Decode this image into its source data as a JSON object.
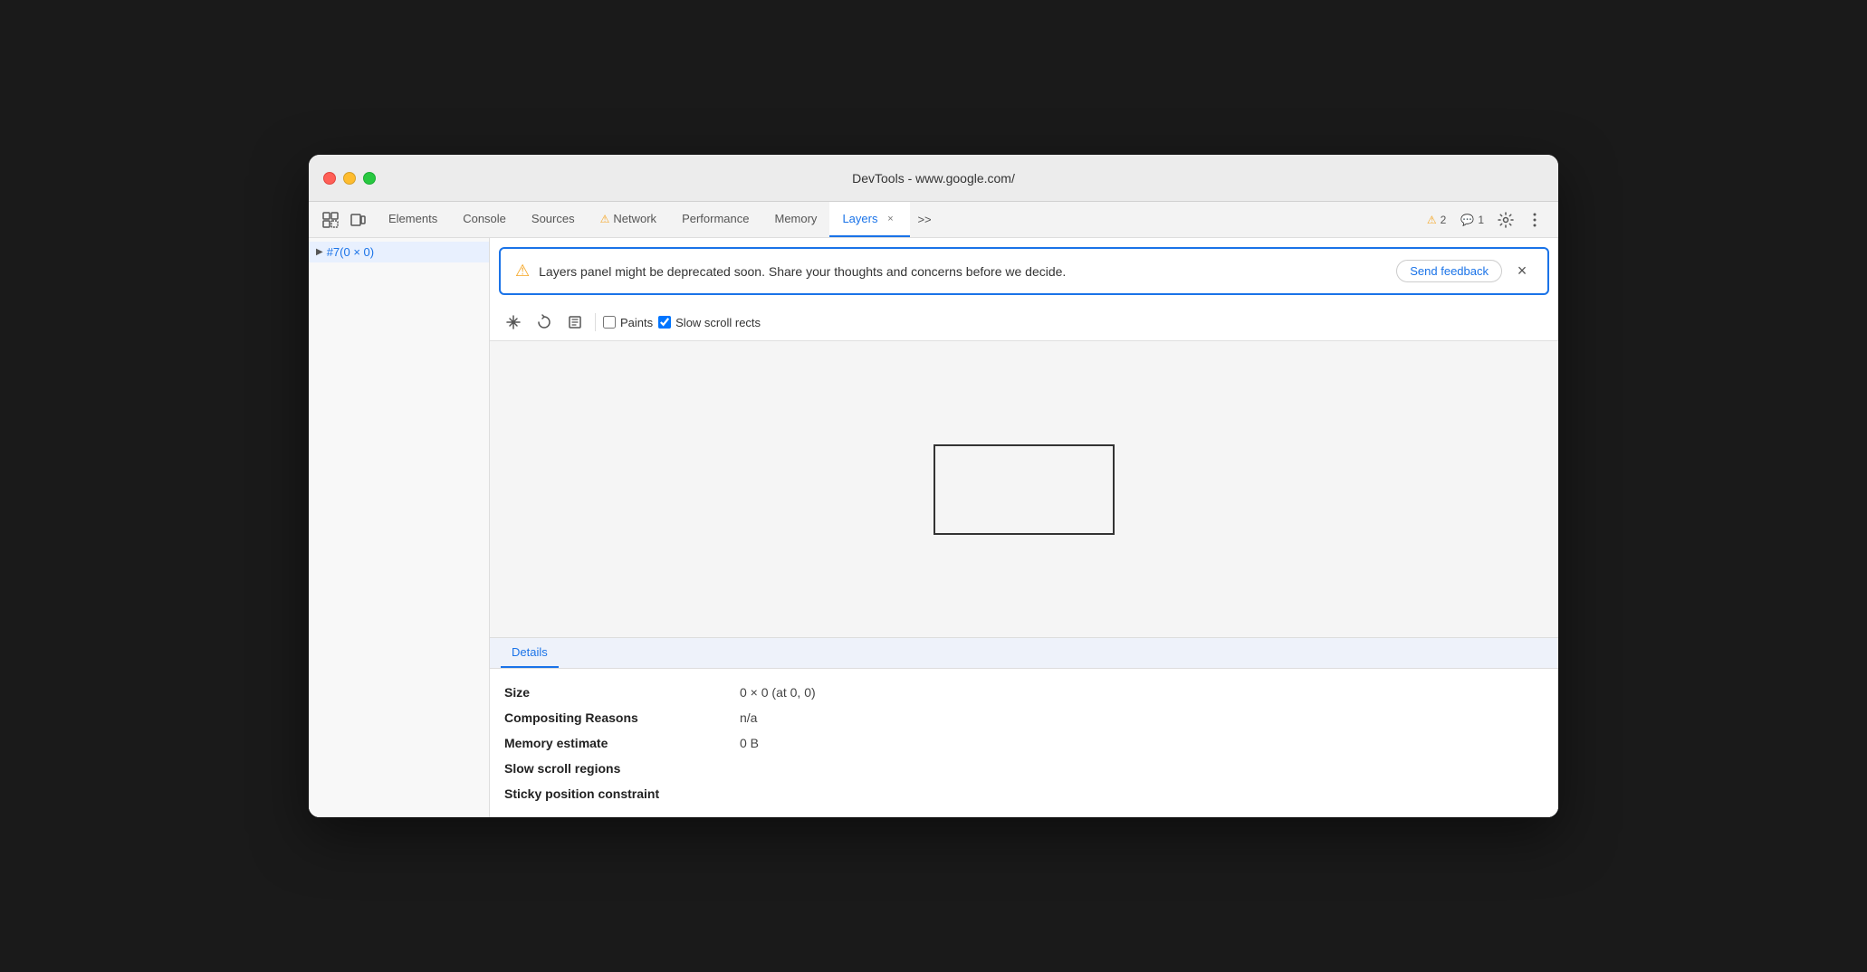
{
  "window": {
    "title": "DevTools - www.google.com/"
  },
  "tabbar": {
    "icons": [
      {
        "name": "inspect-icon",
        "symbol": "⬚",
        "interactable": true
      },
      {
        "name": "device-icon",
        "symbol": "▣",
        "interactable": true
      }
    ],
    "tabs": [
      {
        "id": "elements",
        "label": "Elements",
        "active": false,
        "hasWarning": false,
        "closable": false
      },
      {
        "id": "console",
        "label": "Console",
        "active": false,
        "hasWarning": false,
        "closable": false
      },
      {
        "id": "sources",
        "label": "Sources",
        "active": false,
        "hasWarning": false,
        "closable": false
      },
      {
        "id": "network",
        "label": "Network",
        "active": false,
        "hasWarning": true,
        "closable": false
      },
      {
        "id": "performance",
        "label": "Performance",
        "active": false,
        "hasWarning": false,
        "closable": false
      },
      {
        "id": "memory",
        "label": "Memory",
        "active": false,
        "hasWarning": false,
        "closable": false
      },
      {
        "id": "layers",
        "label": "Layers",
        "active": true,
        "hasWarning": false,
        "closable": true
      }
    ],
    "overflow_label": ">>",
    "warnings_count": "2",
    "messages_count": "1"
  },
  "sidebar": {
    "items": [
      {
        "label": "#7(0 × 0)",
        "selected": true
      }
    ]
  },
  "banner": {
    "text": "Layers panel might be deprecated soon. Share your thoughts and concerns before we decide.",
    "feedback_button": "Send feedback",
    "close_label": "×"
  },
  "toolbar": {
    "paints_label": "Paints",
    "slow_scroll_label": "Slow scroll rects",
    "paints_checked": false,
    "slow_scroll_checked": true
  },
  "details": {
    "tab_label": "Details",
    "rows": [
      {
        "label": "Size",
        "value": "0 × 0 (at 0, 0)"
      },
      {
        "label": "Compositing Reasons",
        "value": "n/a"
      },
      {
        "label": "Memory estimate",
        "value": "0 B"
      },
      {
        "label": "Slow scroll regions",
        "value": ""
      },
      {
        "label": "Sticky position constraint",
        "value": ""
      }
    ]
  },
  "colors": {
    "accent": "#1a73e8",
    "warning": "#f5a623",
    "active_tab_indicator": "#1a73e8"
  }
}
